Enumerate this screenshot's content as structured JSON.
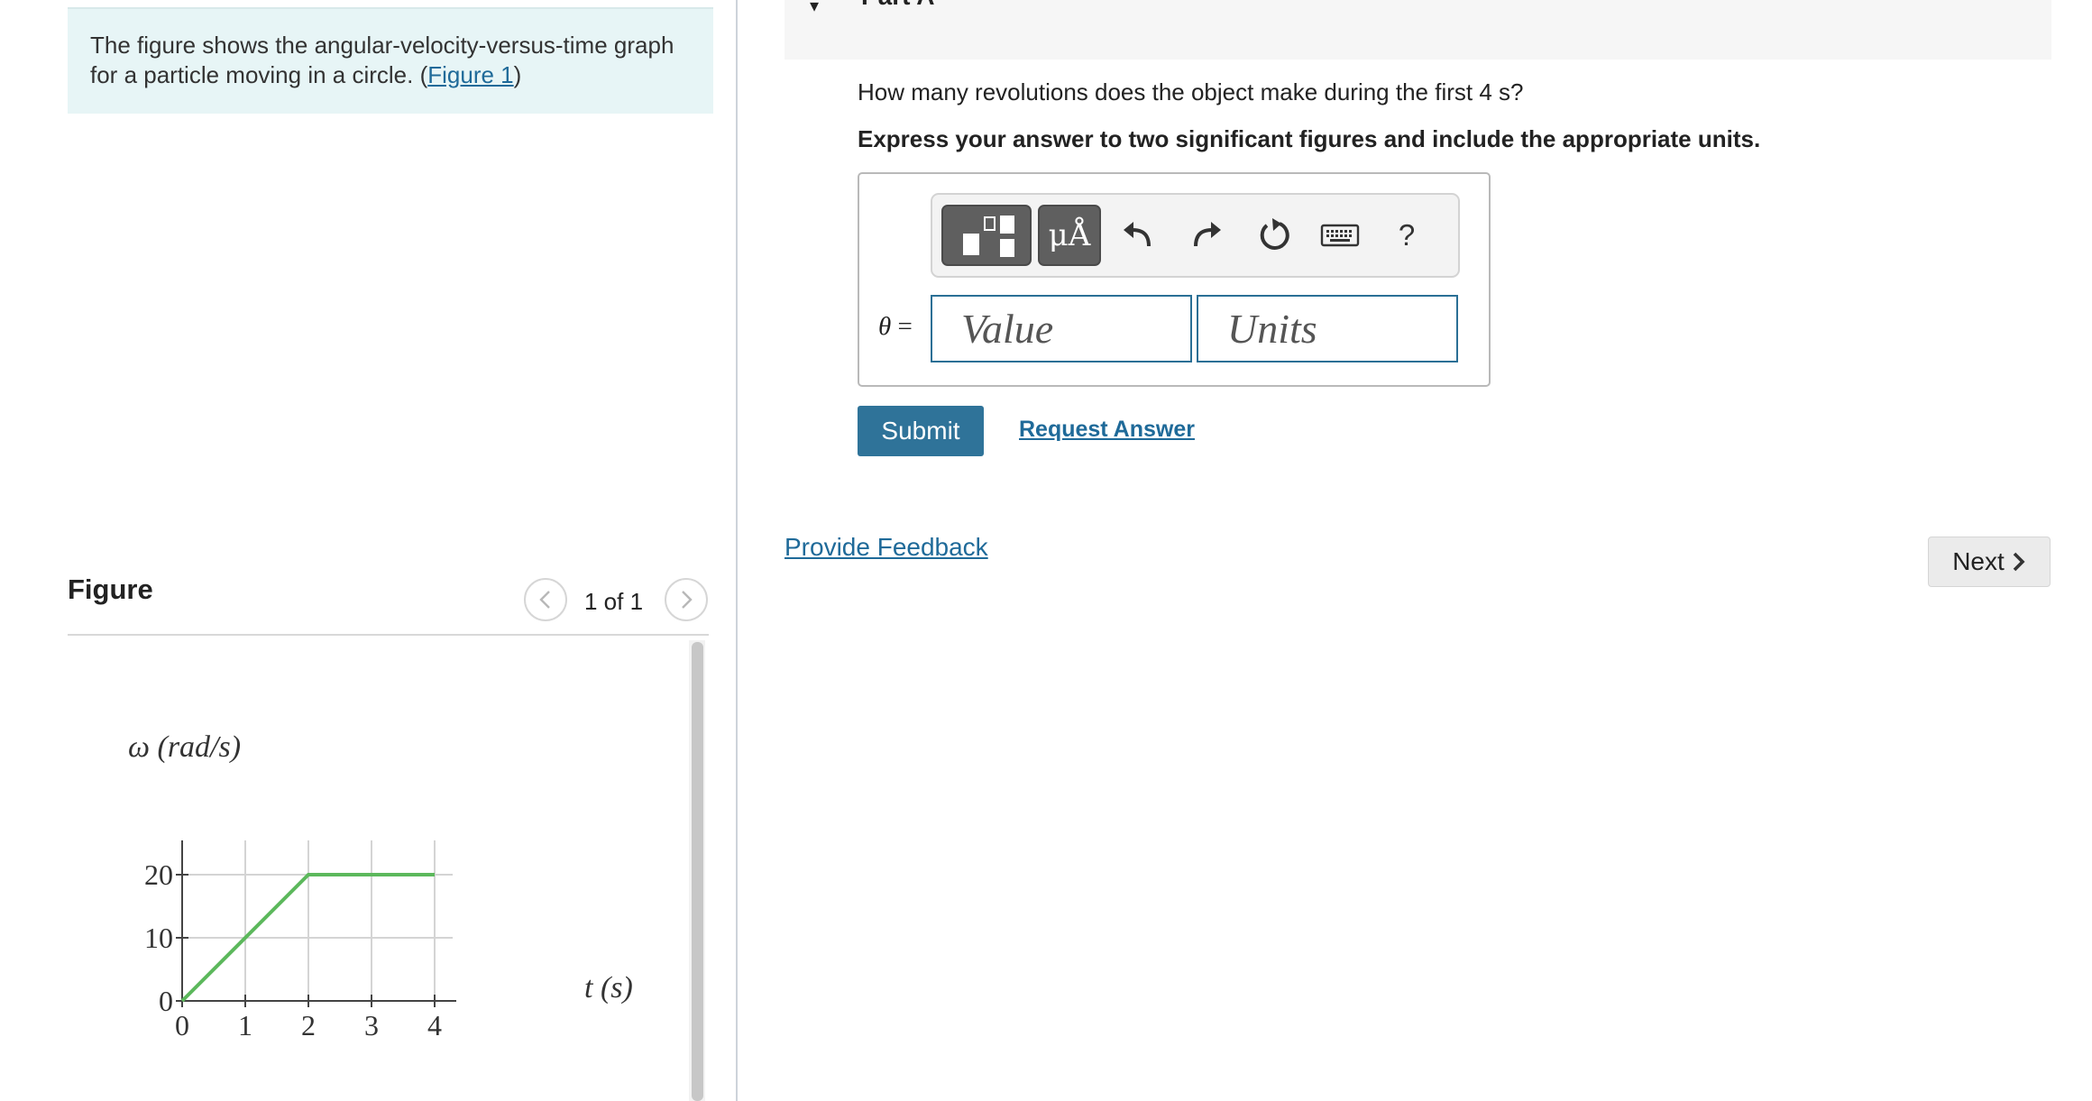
{
  "intro": {
    "text": "The figure shows the angular-velocity-versus-time graph for a particle moving in a circle. (",
    "link": "Figure 1",
    "text_end": ")"
  },
  "figure_panel": {
    "heading": "Figure",
    "pager": "1 of 1",
    "prev_icon": "chevron-left-icon",
    "next_icon": "chevron-right-icon"
  },
  "part": {
    "title": "Part A",
    "question": "How many revolutions does the object make during the first 4 s?",
    "instruction": "Express your answer to two significant figures and include the appropriate units."
  },
  "toolbar": {
    "units_label": "μÅ",
    "help_label": "?",
    "icons": [
      "templates-icon",
      "units-icon",
      "undo-icon",
      "redo-icon",
      "reset-icon",
      "keyboard-icon",
      "help-icon"
    ]
  },
  "answer": {
    "variable": "θ",
    "equals": "=",
    "value_placeholder": "Value",
    "value": "",
    "units_placeholder": "Units",
    "units": ""
  },
  "actions": {
    "submit": "Submit",
    "request_answer": "Request Answer",
    "feedback": "Provide Feedback",
    "next": "Next"
  },
  "colors": {
    "accent": "#2f7399",
    "link": "#1f6a99",
    "graph_line": "#5cb85c",
    "intro_bg": "#e7f5f6"
  },
  "chart_data": {
    "type": "line",
    "title": "",
    "xlabel": "t (s)",
    "ylabel": "ω (rad/s)",
    "x_ticks": [
      "0",
      "1",
      "2",
      "3",
      "4"
    ],
    "y_ticks": [
      "0",
      "10",
      "20"
    ],
    "xlim": [
      0,
      4
    ],
    "ylim": [
      0,
      20
    ],
    "grid": true,
    "series": [
      {
        "x": [
          0,
          2,
          4
        ],
        "y": [
          0,
          20,
          20
        ]
      }
    ]
  }
}
